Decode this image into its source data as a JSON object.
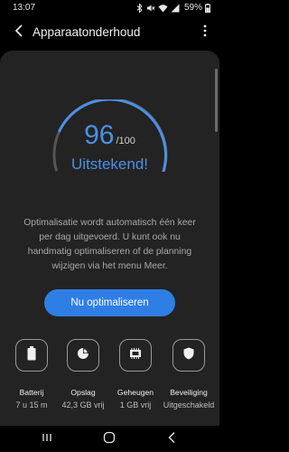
{
  "status_bar": {
    "time": "13:07",
    "battery": "59%",
    "icons": [
      "bluetooth-icon",
      "mute-icon",
      "wifi-icon",
      "signal-icon",
      "battery-icon"
    ]
  },
  "app_bar": {
    "title": "Apparaatonderhoud",
    "back_icon": "arrow-back-icon",
    "more_icon": "more-vert-icon"
  },
  "score": {
    "value": "96",
    "max": "/100",
    "rating": "Uitstekend!",
    "fraction": 0.96
  },
  "description": "Optimalisatie wordt automatisch één keer per dag uitgevoerd. U kunt ook nu handmatig optimaliseren of de planning wijzigen via het menu Meer.",
  "optimize_button": "Nu optimaliseren",
  "items": [
    {
      "label": "Batterij",
      "value": "7 u 15 m",
      "icon": "battery-icon"
    },
    {
      "label": "Opslag",
      "value": "42,3 GB vrij",
      "icon": "storage-pie-icon"
    },
    {
      "label": "Geheugen",
      "value": "1 GB vrij",
      "icon": "memory-chip-icon"
    },
    {
      "label": "Beveiliging",
      "value": "Uitgeschakeld",
      "icon": "shield-icon"
    }
  ],
  "colors": {
    "accent": "#4d8fe6",
    "button": "#2f7ee6",
    "card": "#232323",
    "background": "#000000"
  },
  "nav_bar": [
    "recents-icon",
    "home-icon",
    "back-icon"
  ]
}
